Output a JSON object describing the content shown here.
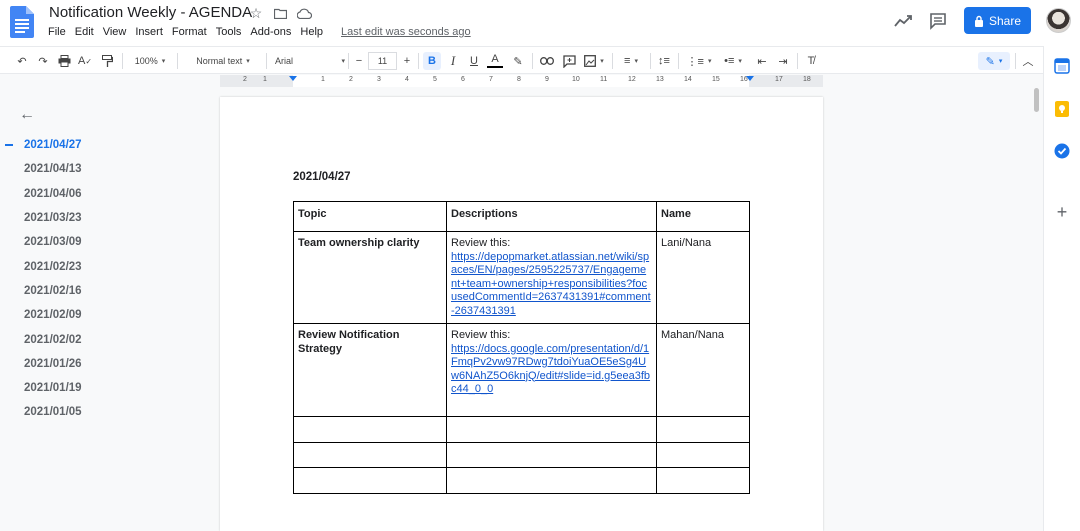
{
  "doc": {
    "title": "Notification Weekly - AGENDA",
    "last_edit": "Last edit was seconds ago"
  },
  "menu": [
    "File",
    "Edit",
    "View",
    "Insert",
    "Format",
    "Tools",
    "Add-ons",
    "Help"
  ],
  "share": {
    "label": "Share"
  },
  "toolbar": {
    "zoom": "100%",
    "style": "Normal text",
    "font": "Arial",
    "font_size": "11",
    "minus": "−",
    "plus": "+",
    "bold": "B",
    "italic": "I",
    "underline": "U",
    "text_color": "A"
  },
  "ruler": {
    "numbers": [
      "2",
      "1",
      "1",
      "2",
      "3",
      "4",
      "5",
      "6",
      "7",
      "8",
      "9",
      "10",
      "11",
      "12",
      "13",
      "14",
      "15",
      "16",
      "17",
      "18"
    ]
  },
  "outline": {
    "active_index": 0,
    "items": [
      "2021/04/27",
      "2021/04/13",
      "2021/04/06",
      "2021/03/23",
      "2021/03/09",
      "2021/02/23",
      "2021/02/16",
      "2021/02/09",
      "2021/02/02",
      "2021/01/26",
      "2021/01/19",
      "2021/01/05"
    ]
  },
  "page": {
    "heading": "2021/04/27",
    "table": {
      "headers": [
        "Topic",
        "Descriptions",
        "Name"
      ],
      "rows": [
        {
          "topic": "Team ownership clarity",
          "desc_prefix": "Review this:",
          "link": "https://depopmarket.atlassian.net/wiki/spaces/EN/pages/2595225737/Engagement+team+ownership+responsibilities?focusedCommentId=2637431391#comment-2637431391",
          "name": "Lani/Nana"
        },
        {
          "topic": "Review Notification Strategy",
          "desc_prefix": "Review this:",
          "link": "https://docs.google.com/presentation/d/1FmqPv2vw97RDwg7tdoiYuaOE5eSg4Uw6NAhZ5O6knjQ/edit#slide=id.g5eea3fbc44_0_0",
          "name": "Mahan/Nana"
        },
        {
          "topic": "",
          "desc_prefix": "",
          "link": "",
          "name": ""
        },
        {
          "topic": "",
          "desc_prefix": "",
          "link": "",
          "name": ""
        },
        {
          "topic": "",
          "desc_prefix": "",
          "link": "",
          "name": ""
        }
      ]
    }
  },
  "colors": {
    "accent": "#1a73e8",
    "link": "#1155cc"
  },
  "icons": {
    "doc_logo": "google-docs-icon",
    "star": "star-icon",
    "move": "move-to-folder-icon",
    "cloud": "cloud-saved-icon"
  }
}
